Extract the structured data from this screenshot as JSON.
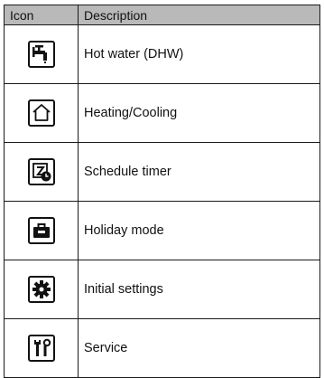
{
  "table": {
    "headers": {
      "icon": "Icon",
      "description": "Description"
    },
    "rows": [
      {
        "icon": "faucet-icon",
        "description": "Hot water (DHW)"
      },
      {
        "icon": "house-icon",
        "description": "Heating/Cooling"
      },
      {
        "icon": "schedule-timer-icon",
        "description": "Schedule timer"
      },
      {
        "icon": "suitcase-icon",
        "description": "Holiday mode"
      },
      {
        "icon": "gear-icon",
        "description": "Initial settings"
      },
      {
        "icon": "wrench-screwdriver-icon",
        "description": "Service"
      }
    ]
  }
}
